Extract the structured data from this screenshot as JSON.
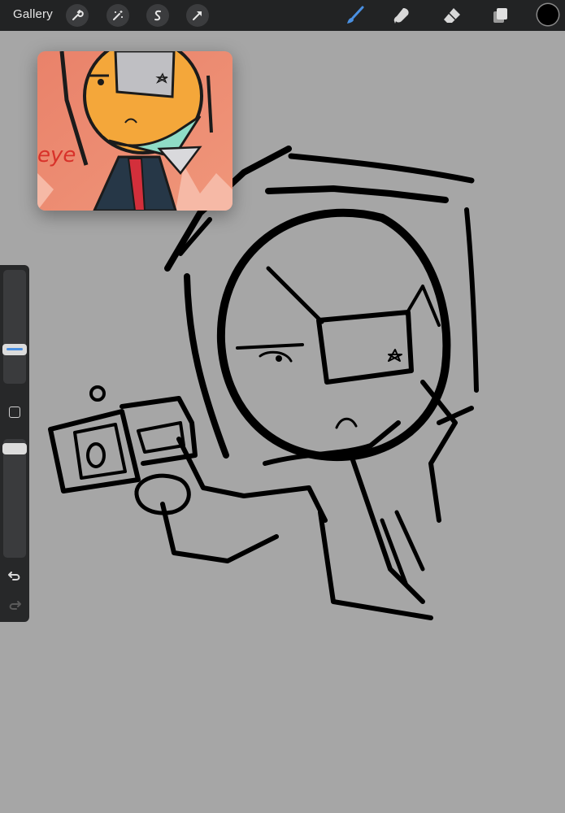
{
  "toolbar": {
    "gallery_label": "Gallery",
    "left_tools": [
      "wrench-icon",
      "magic-wand-icon",
      "selection-s-icon",
      "transform-arrow-icon"
    ],
    "right_tools": [
      "brush-icon",
      "smudge-icon",
      "eraser-icon",
      "layers-icon"
    ],
    "active_tool": "brush",
    "active_color": "#4a90e2",
    "current_color": "#000000"
  },
  "sidebar": {
    "brush_size_level": 0.28,
    "opacity_level": 0.04,
    "controls": [
      "size-slider",
      "modify-button",
      "opacity-slider",
      "undo-icon",
      "redo-icon"
    ]
  },
  "reference_window": {
    "visible_text": "eye"
  },
  "theme": {
    "canvas_bg": "#a6a6a6",
    "toolbar_bg": "#222324",
    "accent": "#4a90e2"
  }
}
